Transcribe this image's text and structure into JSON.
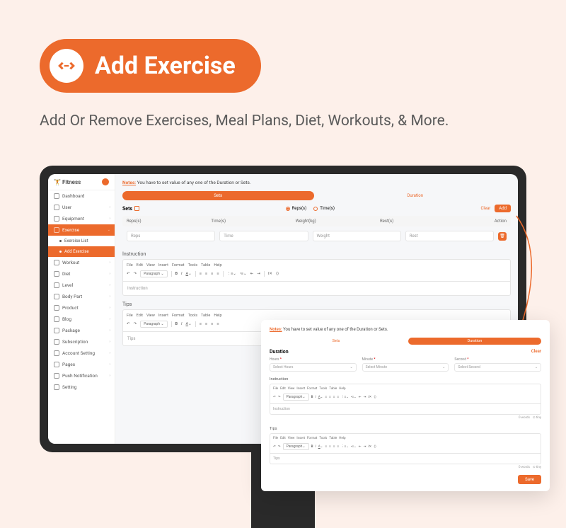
{
  "hero": {
    "title": "Add Exercise"
  },
  "subtitle": "Add Or Remove Exercises, Meal Plans, Diet, Workouts, & More.",
  "sidebar": {
    "brand": "Fitness",
    "items": [
      {
        "label": "Dashboard",
        "icon": "dashboard",
        "expandable": false
      },
      {
        "label": "User",
        "icon": "user",
        "expandable": true
      },
      {
        "label": "Equipment",
        "icon": "equipment",
        "expandable": true
      },
      {
        "label": "Exercise",
        "icon": "exercise",
        "expandable": true,
        "active": true,
        "subs": [
          {
            "label": "Exercise List",
            "active": false
          },
          {
            "label": "Add Exercise",
            "active": true
          }
        ]
      },
      {
        "label": "Workout",
        "icon": "workout",
        "expandable": true
      },
      {
        "label": "Diet",
        "icon": "diet",
        "expandable": true
      },
      {
        "label": "Level",
        "icon": "level",
        "expandable": true
      },
      {
        "label": "Body Part",
        "icon": "bodypart",
        "expandable": true
      },
      {
        "label": "Product",
        "icon": "product",
        "expandable": true
      },
      {
        "label": "Blog",
        "icon": "blog",
        "expandable": true
      },
      {
        "label": "Package",
        "icon": "package",
        "expandable": true
      },
      {
        "label": "Subscription",
        "icon": "subscription",
        "expandable": true
      },
      {
        "label": "Account Setting",
        "icon": "account",
        "expandable": true
      },
      {
        "label": "Pages",
        "icon": "pages",
        "expandable": true
      },
      {
        "label": "Push Notification",
        "icon": "push",
        "expandable": true
      },
      {
        "label": "Setting",
        "icon": "setting",
        "expandable": false
      }
    ]
  },
  "main": {
    "notes_label": "Notes:",
    "notes_text": "You have to set value of any one of the Duration or Sets.",
    "tabs": {
      "sets": "Sets",
      "duration": "Duration"
    },
    "sets": {
      "title": "Sets",
      "radios": {
        "reps": "Reps(s)",
        "time": "Time(s)"
      },
      "clear": "Clear",
      "add": "Add",
      "columns": {
        "reps": "Reps(s)",
        "time": "Time(s)",
        "weight": "Weight(kg)",
        "rest": "Rest(s)",
        "action": "Action"
      },
      "placeholders": {
        "reps": "Reps",
        "time": "Time",
        "weight": "Weight",
        "rest": "Rest"
      }
    },
    "editor": {
      "instruction_label": "Instruction",
      "instruction_placeholder": "Instruction",
      "tips_label": "Tips",
      "tips_placeholder": "Tips",
      "menu": {
        "file": "File",
        "edit": "Edit",
        "view": "View",
        "insert": "Insert",
        "format": "Format",
        "tools": "Tools",
        "table": "Table",
        "help": "Help"
      },
      "paragraph": "Paragraph"
    }
  },
  "overlay": {
    "notes_label": "Notes:",
    "notes_text": "You have to set value of any one of the Duration or Sets.",
    "tabs": {
      "sets": "Sets",
      "duration": "Duration"
    },
    "duration": {
      "title": "Duration",
      "clear": "Clear",
      "fields": {
        "hours": {
          "label": "Hours",
          "placeholder": "Select Hours"
        },
        "minute": {
          "label": "Minute",
          "placeholder": "Select Minute"
        },
        "second": {
          "label": "Second",
          "placeholder": "Select Second"
        }
      }
    },
    "editor": {
      "instruction_label": "Instruction",
      "instruction_placeholder": "Instruction",
      "tips_label": "Tips",
      "tips_placeholder": "Tips",
      "menu": {
        "file": "File",
        "edit": "Edit",
        "view": "View",
        "insert": "Insert",
        "format": "Format",
        "tools": "Tools",
        "table": "Table",
        "help": "Help"
      },
      "paragraph": "Paragraph",
      "words": "0 words",
      "tiny": "tiny"
    },
    "save": "Save"
  }
}
